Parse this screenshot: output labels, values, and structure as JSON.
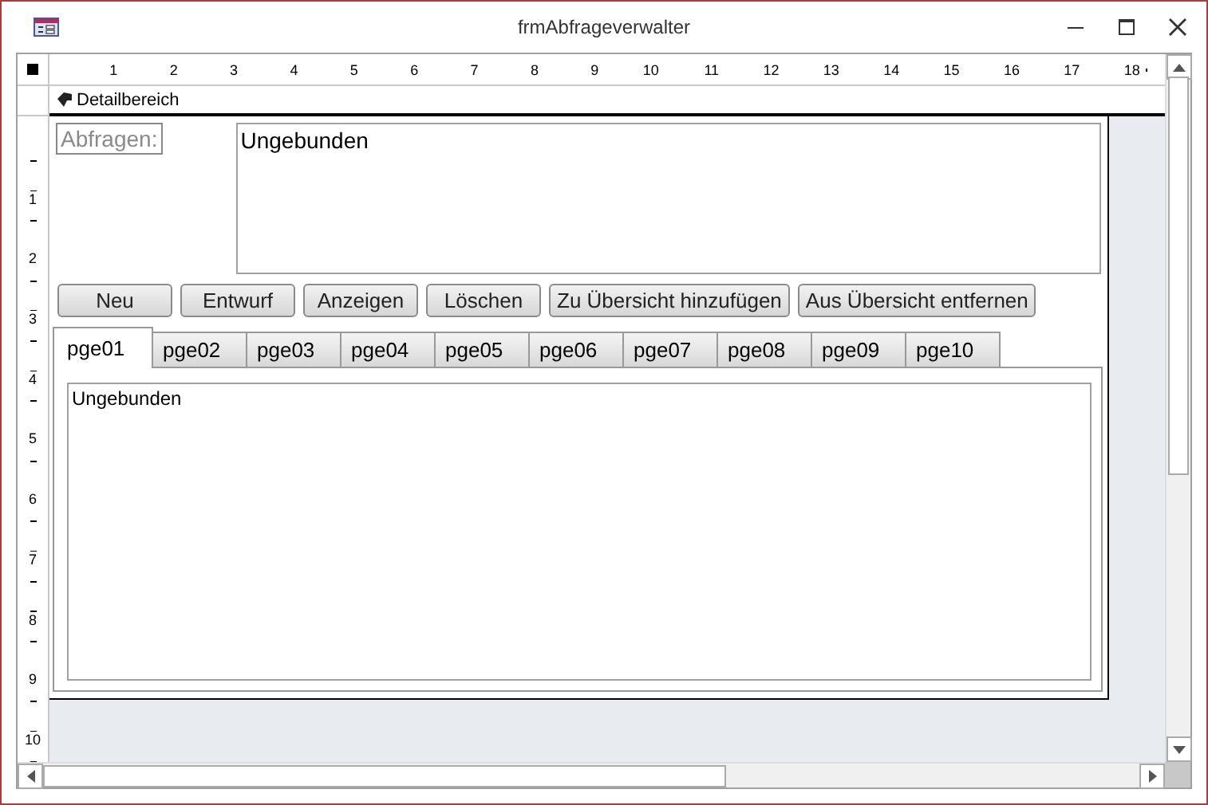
{
  "window": {
    "title": "frmAbfrageverwalter"
  },
  "ruler": {
    "horizontal": [
      "1",
      "2",
      "3",
      "4",
      "5",
      "6",
      "7",
      "8",
      "9",
      "10",
      "11",
      "12",
      "13",
      "14",
      "15",
      "16",
      "17",
      "18"
    ],
    "vertical": [
      "1",
      "2",
      "3",
      "4",
      "5",
      "6",
      "7",
      "8",
      "9",
      "10"
    ]
  },
  "section": {
    "title": "Detailbereich"
  },
  "form": {
    "label": "Abfragen:",
    "textbox": "Ungebunden",
    "buttons": [
      "Neu",
      "Entwurf",
      "Anzeigen",
      "Löschen",
      "Zu Übersicht hinzufügen",
      "Aus Übersicht entfernen"
    ],
    "tabs": [
      {
        "label": "pge01",
        "selected": true
      },
      {
        "label": "pge02",
        "selected": false
      },
      {
        "label": "pge03",
        "selected": false
      },
      {
        "label": "pge04",
        "selected": false
      },
      {
        "label": "pge05",
        "selected": false
      },
      {
        "label": "pge06",
        "selected": false
      },
      {
        "label": "pge07",
        "selected": false
      },
      {
        "label": "pge08",
        "selected": false
      },
      {
        "label": "pge09",
        "selected": false
      },
      {
        "label": "pge10",
        "selected": false
      }
    ],
    "subform": "Ungebunden"
  }
}
